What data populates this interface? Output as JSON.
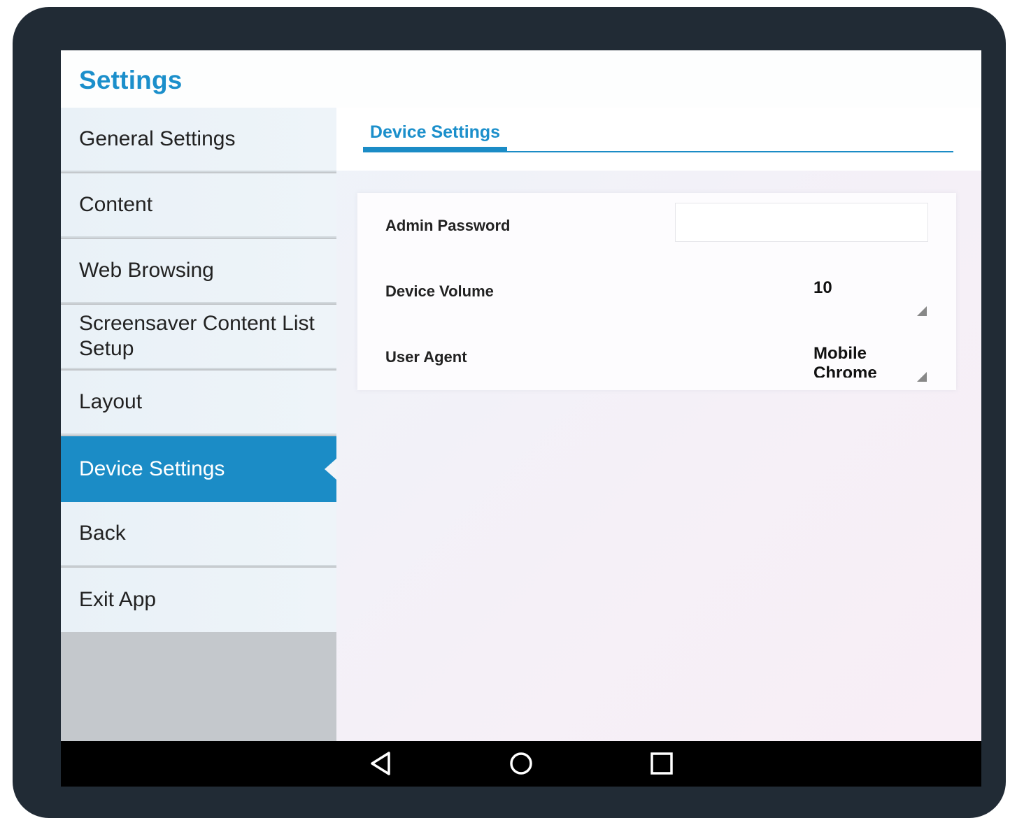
{
  "app": {
    "title": "Settings"
  },
  "sidebar": {
    "items": [
      {
        "label": "General Settings"
      },
      {
        "label": "Content"
      },
      {
        "label": "Web Browsing"
      },
      {
        "label": "Screensaver Content List Setup"
      },
      {
        "label": "Layout"
      },
      {
        "label": "Device Settings",
        "active": true
      },
      {
        "label": "Back"
      },
      {
        "label": "Exit App"
      }
    ]
  },
  "tabs": [
    {
      "label": "Device Settings",
      "active": true
    }
  ],
  "settings": {
    "admin_password": {
      "label": "Admin Password",
      "value": ""
    },
    "device_volume": {
      "label": "Device Volume",
      "value": "10"
    },
    "user_agent": {
      "label": "User Agent",
      "value": "Mobile Chrome"
    }
  },
  "navbar": {
    "back_icon": "triangle-back-icon",
    "home_icon": "circle-home-icon",
    "recents_icon": "square-recents-icon"
  },
  "colors": {
    "accent": "#1b8cc6",
    "frame": "#212b35",
    "sidebar_empty": "#c4c8cc"
  }
}
